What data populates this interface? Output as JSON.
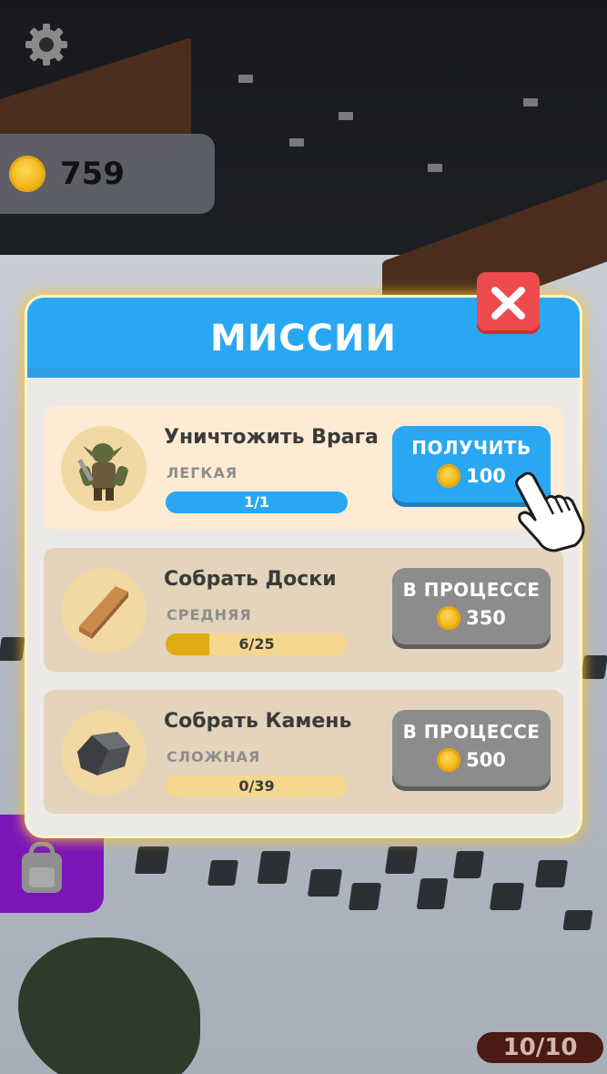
{
  "hud": {
    "coins": "759",
    "capacity": "10/10"
  },
  "modal": {
    "title": "МИССИИ"
  },
  "missions": [
    {
      "title": "Уничтожить Врага",
      "difficulty": "ЛЕГКАЯ",
      "progress_text": "1/1",
      "progress_fraction": 1.0,
      "button_label": "ПОЛУЧИТЬ",
      "reward": "100",
      "icon": "goblin-icon",
      "state": "claimable"
    },
    {
      "title": "Собрать Доски",
      "difficulty": "СРЕДНЯЯ",
      "progress_text": "6/25",
      "progress_fraction": 0.24,
      "button_label": "В ПРОЦЕССЕ",
      "reward": "350",
      "icon": "plank-icon",
      "state": "in-progress"
    },
    {
      "title": "Собрать Камень",
      "difficulty": "СЛОЖНАЯ",
      "progress_text": "0/39",
      "progress_fraction": 0.0,
      "button_label": "В ПРОЦЕССЕ",
      "reward": "500",
      "icon": "stone-icon",
      "state": "in-progress"
    }
  ],
  "colors": {
    "header_blue": "#2aa7f3",
    "claimable_bar": "#2aa7f3",
    "progress_bar": "#e0aa10",
    "bar_track": "#f5d78e",
    "close_red": "#ee4b4f",
    "inactive_button": "#8c8c8c"
  }
}
